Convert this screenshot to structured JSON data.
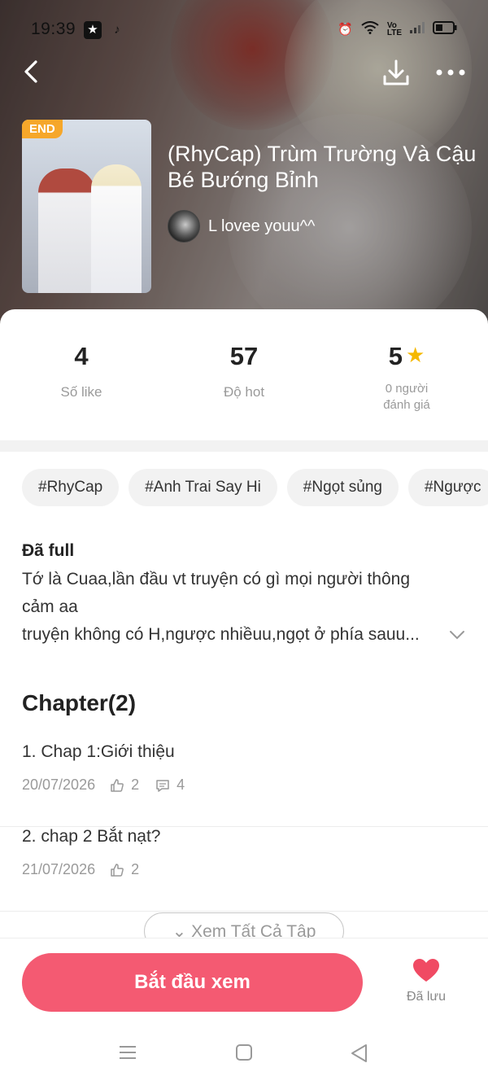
{
  "status_bar": {
    "time": "19:39",
    "icons": [
      "gallery-app-icon",
      "tiktok-icon",
      "alarm-icon",
      "wifi-icon",
      "volte-icon",
      "signal-icon",
      "battery-icon"
    ]
  },
  "toolbar": {
    "back_icon": "chevron-left-icon",
    "download_icon": "download-icon",
    "more_icon": "more-dots-icon"
  },
  "book": {
    "badge": "END",
    "title": "(RhyCap) Trùm Trường Và Cậu Bé Bướng Bỉnh",
    "author": "L lovee youu^^"
  },
  "stats": {
    "likes_value": "4",
    "likes_label": "Số like",
    "hot_value": "57",
    "hot_label": "Độ hot",
    "rating_value": "5",
    "rating_label_line1": "0 người",
    "rating_label_line2": "đánh giá"
  },
  "tags": [
    "#RhyCap",
    "#Anh Trai Say Hi",
    "#Ngọt sủng",
    "#Ngược"
  ],
  "description": {
    "status": "Đã full",
    "line1": "Tớ là Cuaa,lần đầu vt truyện có gì mọi người thông",
    "line2": "cảm aa",
    "line3": "truyện không có H,ngược nhiềuu,ngọt ở phía sauu..."
  },
  "chapters": {
    "heading": "Chapter(2)",
    "items": [
      {
        "title": "1. Chap 1:Giới thiệu",
        "date": "20/07/2026",
        "likes": "2",
        "comments": "4"
      },
      {
        "title": "2. chap 2 Bắt nạt?",
        "date": "21/07/2026",
        "likes": "2",
        "comments": ""
      }
    ],
    "see_all": "Xem Tất Cả Tập"
  },
  "bottom": {
    "start_button": "Bắt đầu xem",
    "saved_label": "Đã lưu"
  },
  "colors": {
    "accent": "#f45a72",
    "badge": "#f6a72a",
    "star": "#f5b800"
  }
}
